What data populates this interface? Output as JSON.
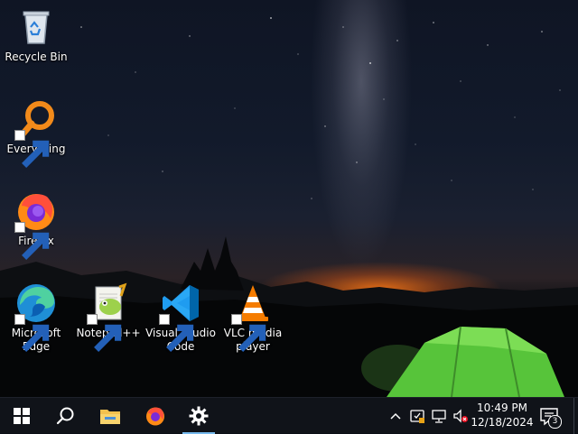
{
  "desktop": {
    "icons": [
      {
        "label": "Recycle Bin",
        "icon": "recycle-bin-icon"
      },
      {
        "label": "Everything",
        "icon": "everything-search-icon"
      },
      {
        "label": "Firefox",
        "icon": "firefox-icon"
      },
      {
        "label": "Microsoft Edge",
        "icon": "edge-icon"
      },
      {
        "label": "Notepad++",
        "icon": "notepadpp-icon"
      },
      {
        "label": "Visual Studio Code",
        "icon": "vscode-icon"
      },
      {
        "label": "VLC media player",
        "icon": "vlc-icon"
      }
    ]
  },
  "taskbar": {
    "buttons": [
      {
        "icon": "windows-start-icon"
      },
      {
        "icon": "search-icon"
      },
      {
        "icon": "file-explorer-icon"
      },
      {
        "icon": "firefox-icon"
      },
      {
        "icon": "settings-gear-icon",
        "active": true
      }
    ],
    "tray": [
      "chevron-up-icon",
      "app-tray-icon",
      "network-icon",
      "volume-muted-icon"
    ],
    "clock": {
      "time": "10:49 PM",
      "date": "12/18/2024"
    },
    "notifications": {
      "count": "3"
    }
  },
  "colors": {
    "taskbar": "#101319",
    "accent": "#76b9ed"
  }
}
